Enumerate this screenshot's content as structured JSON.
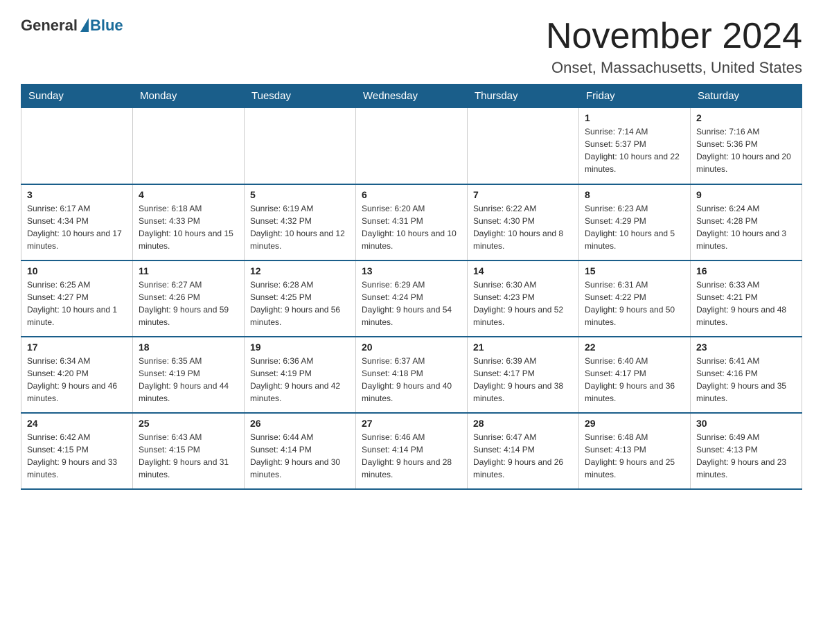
{
  "header": {
    "logo_general": "General",
    "logo_blue": "Blue",
    "title": "November 2024",
    "subtitle": "Onset, Massachusetts, United States"
  },
  "calendar": {
    "days_of_week": [
      "Sunday",
      "Monday",
      "Tuesday",
      "Wednesday",
      "Thursday",
      "Friday",
      "Saturday"
    ],
    "weeks": [
      [
        {
          "day": "",
          "info": ""
        },
        {
          "day": "",
          "info": ""
        },
        {
          "day": "",
          "info": ""
        },
        {
          "day": "",
          "info": ""
        },
        {
          "day": "",
          "info": ""
        },
        {
          "day": "1",
          "info": "Sunrise: 7:14 AM\nSunset: 5:37 PM\nDaylight: 10 hours and 22 minutes."
        },
        {
          "day": "2",
          "info": "Sunrise: 7:16 AM\nSunset: 5:36 PM\nDaylight: 10 hours and 20 minutes."
        }
      ],
      [
        {
          "day": "3",
          "info": "Sunrise: 6:17 AM\nSunset: 4:34 PM\nDaylight: 10 hours and 17 minutes."
        },
        {
          "day": "4",
          "info": "Sunrise: 6:18 AM\nSunset: 4:33 PM\nDaylight: 10 hours and 15 minutes."
        },
        {
          "day": "5",
          "info": "Sunrise: 6:19 AM\nSunset: 4:32 PM\nDaylight: 10 hours and 12 minutes."
        },
        {
          "day": "6",
          "info": "Sunrise: 6:20 AM\nSunset: 4:31 PM\nDaylight: 10 hours and 10 minutes."
        },
        {
          "day": "7",
          "info": "Sunrise: 6:22 AM\nSunset: 4:30 PM\nDaylight: 10 hours and 8 minutes."
        },
        {
          "day": "8",
          "info": "Sunrise: 6:23 AM\nSunset: 4:29 PM\nDaylight: 10 hours and 5 minutes."
        },
        {
          "day": "9",
          "info": "Sunrise: 6:24 AM\nSunset: 4:28 PM\nDaylight: 10 hours and 3 minutes."
        }
      ],
      [
        {
          "day": "10",
          "info": "Sunrise: 6:25 AM\nSunset: 4:27 PM\nDaylight: 10 hours and 1 minute."
        },
        {
          "day": "11",
          "info": "Sunrise: 6:27 AM\nSunset: 4:26 PM\nDaylight: 9 hours and 59 minutes."
        },
        {
          "day": "12",
          "info": "Sunrise: 6:28 AM\nSunset: 4:25 PM\nDaylight: 9 hours and 56 minutes."
        },
        {
          "day": "13",
          "info": "Sunrise: 6:29 AM\nSunset: 4:24 PM\nDaylight: 9 hours and 54 minutes."
        },
        {
          "day": "14",
          "info": "Sunrise: 6:30 AM\nSunset: 4:23 PM\nDaylight: 9 hours and 52 minutes."
        },
        {
          "day": "15",
          "info": "Sunrise: 6:31 AM\nSunset: 4:22 PM\nDaylight: 9 hours and 50 minutes."
        },
        {
          "day": "16",
          "info": "Sunrise: 6:33 AM\nSunset: 4:21 PM\nDaylight: 9 hours and 48 minutes."
        }
      ],
      [
        {
          "day": "17",
          "info": "Sunrise: 6:34 AM\nSunset: 4:20 PM\nDaylight: 9 hours and 46 minutes."
        },
        {
          "day": "18",
          "info": "Sunrise: 6:35 AM\nSunset: 4:19 PM\nDaylight: 9 hours and 44 minutes."
        },
        {
          "day": "19",
          "info": "Sunrise: 6:36 AM\nSunset: 4:19 PM\nDaylight: 9 hours and 42 minutes."
        },
        {
          "day": "20",
          "info": "Sunrise: 6:37 AM\nSunset: 4:18 PM\nDaylight: 9 hours and 40 minutes."
        },
        {
          "day": "21",
          "info": "Sunrise: 6:39 AM\nSunset: 4:17 PM\nDaylight: 9 hours and 38 minutes."
        },
        {
          "day": "22",
          "info": "Sunrise: 6:40 AM\nSunset: 4:17 PM\nDaylight: 9 hours and 36 minutes."
        },
        {
          "day": "23",
          "info": "Sunrise: 6:41 AM\nSunset: 4:16 PM\nDaylight: 9 hours and 35 minutes."
        }
      ],
      [
        {
          "day": "24",
          "info": "Sunrise: 6:42 AM\nSunset: 4:15 PM\nDaylight: 9 hours and 33 minutes."
        },
        {
          "day": "25",
          "info": "Sunrise: 6:43 AM\nSunset: 4:15 PM\nDaylight: 9 hours and 31 minutes."
        },
        {
          "day": "26",
          "info": "Sunrise: 6:44 AM\nSunset: 4:14 PM\nDaylight: 9 hours and 30 minutes."
        },
        {
          "day": "27",
          "info": "Sunrise: 6:46 AM\nSunset: 4:14 PM\nDaylight: 9 hours and 28 minutes."
        },
        {
          "day": "28",
          "info": "Sunrise: 6:47 AM\nSunset: 4:14 PM\nDaylight: 9 hours and 26 minutes."
        },
        {
          "day": "29",
          "info": "Sunrise: 6:48 AM\nSunset: 4:13 PM\nDaylight: 9 hours and 25 minutes."
        },
        {
          "day": "30",
          "info": "Sunrise: 6:49 AM\nSunset: 4:13 PM\nDaylight: 9 hours and 23 minutes."
        }
      ]
    ]
  }
}
